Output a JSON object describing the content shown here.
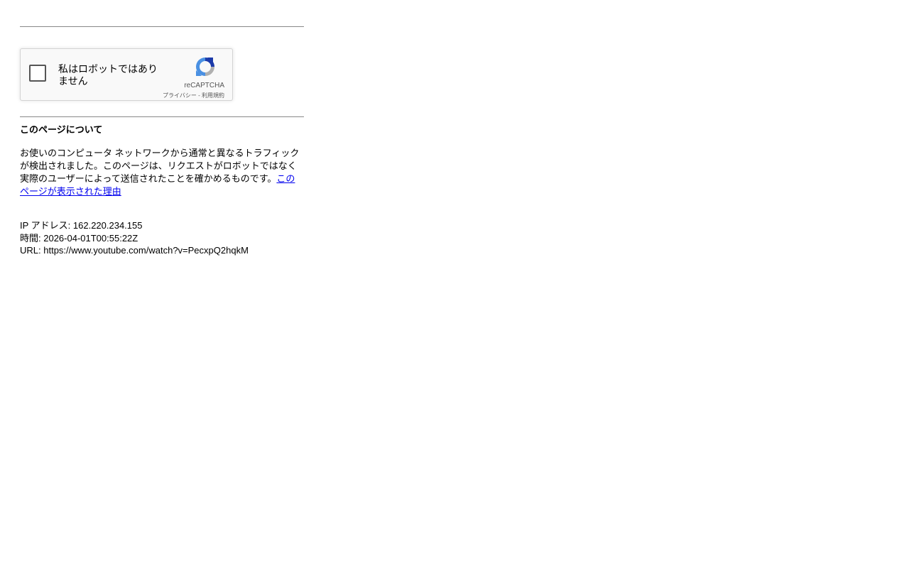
{
  "recaptcha": {
    "label": "私はロボットではありません",
    "brand": "reCAPTCHA",
    "privacy_link": "プライバシー",
    "separator": " - ",
    "terms_link": "利用規約",
    "colors": {
      "logo_blue": "#4a90e2",
      "logo_dark_blue": "#1c3aa9",
      "logo_gray": "#b0b0b0"
    }
  },
  "about": {
    "title": "このページについて",
    "body": "お使いのコンピュータ ネットワークから通常と異なるトラフィックが検出されました。このページは、リクエストがロボットではなく実際のユーザーによって送信されたことを確かめるものです。",
    "link_text": "このページが表示された理由"
  },
  "info": {
    "ip_label": "IP アドレス: ",
    "ip_value": "162.220.234.155",
    "time_label": "時間: ",
    "time_value": "2026-04-01T00:55:22Z",
    "url_label": "URL: ",
    "url_value": "https://www.youtube.com/watch?v=PecxpQ2hqkM"
  }
}
